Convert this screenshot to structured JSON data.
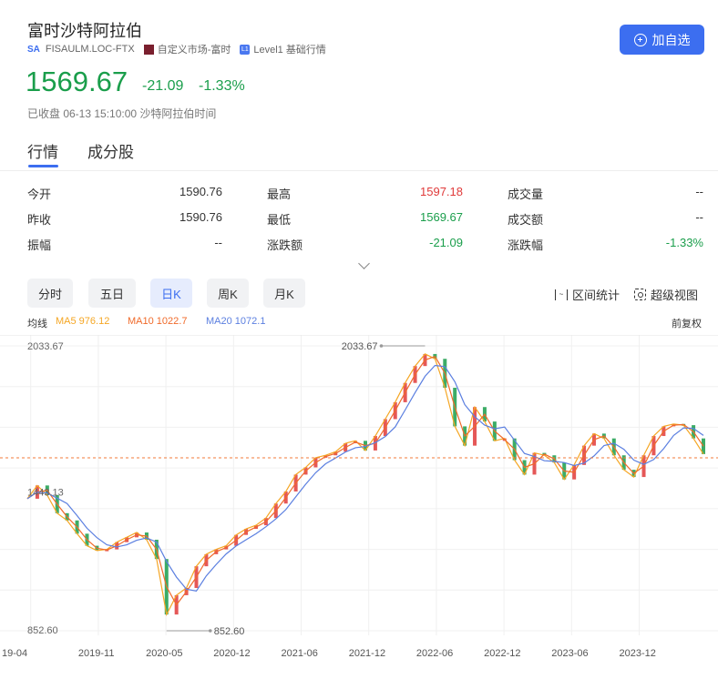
{
  "header": {
    "title": "富时沙特阿拉伯",
    "market_badge": "SA",
    "code": "FISAULM.LOC-FTX",
    "market_name": "自定义市场-富时",
    "level_badge": "L1",
    "level_text": "Level1 基础行情",
    "add_button": "加自选"
  },
  "quote": {
    "price": "1569.67",
    "change": "-21.09",
    "change_pct": "-1.33%",
    "status": "已收盘 06-13 15:10:00 沙特阿拉伯时间",
    "color_down": "#1a9e4b",
    "color_up": "#e03a3a"
  },
  "tabs": [
    {
      "label": "行情",
      "active": true
    },
    {
      "label": "成分股",
      "active": false
    }
  ],
  "stats": [
    {
      "label": "今开",
      "value": "1590.76",
      "color": "#333333"
    },
    {
      "label": "昨收",
      "value": "1590.76",
      "color": "#333333"
    },
    {
      "label": "振幅",
      "value": "--",
      "color": "#333333"
    },
    {
      "label": "最高",
      "value": "1597.18",
      "color": "#e03a3a"
    },
    {
      "label": "最低",
      "value": "1569.67",
      "color": "#1a9e4b"
    },
    {
      "label": "涨跌额",
      "value": "-21.09",
      "color": "#1a9e4b"
    },
    {
      "label": "成交量",
      "value": "--",
      "color": "#333333"
    },
    {
      "label": "成交额",
      "value": "--",
      "color": "#333333"
    },
    {
      "label": "涨跌幅",
      "value": "-1.33%",
      "color": "#1a9e4b"
    }
  ],
  "periods": [
    {
      "label": "分时",
      "active": false
    },
    {
      "label": "五日",
      "active": false
    },
    {
      "label": "日K",
      "active": true
    },
    {
      "label": "周K",
      "active": false
    },
    {
      "label": "月K",
      "active": false
    }
  ],
  "tools": {
    "range_stats": "区间统计",
    "super_view": "超级视图",
    "range_icon_glyph": "~"
  },
  "ma": {
    "label": "均线",
    "ma5": "MA5 976.12",
    "ma10": "MA10 1022.7",
    "ma20": "MA20 1072.1",
    "adjust": "前复权",
    "ma5_color": "#f5a623",
    "ma10_color": "#f06a2a",
    "ma20_color": "#5b7fe0"
  },
  "chart_data": {
    "type": "line",
    "y_tick_labels": [
      "2033.67",
      "1443.13",
      "852.60"
    ],
    "y_range": [
      852.6,
      2033.67
    ],
    "max_label": "2033.67",
    "min_label": "852.60",
    "current_price_line": 1569.67,
    "x_tick_labels": [
      "19-04",
      "2019-11",
      "2020-05",
      "2020-12",
      "2021-06",
      "2021-12",
      "2022-06",
      "2022-12",
      "2023-06",
      "2023-12"
    ],
    "series": [
      {
        "values": [
          1400,
          1455,
          1415,
          1340,
          1310,
          1255,
          1205,
          1185,
          1190,
          1220,
          1240,
          1260,
          1230,
          1150,
          920,
          1000,
          1030,
          1120,
          1170,
          1190,
          1205,
          1250,
          1275,
          1290,
          1320,
          1380,
          1430,
          1500,
          1530,
          1570,
          1580,
          1595,
          1630,
          1640,
          1600,
          1660,
          1730,
          1800,
          1880,
          1950,
          2000,
          1980,
          1860,
          1700,
          1620,
          1780,
          1720,
          1640,
          1650,
          1560,
          1500,
          1590,
          1580,
          1550,
          1480,
          1540,
          1620,
          1670,
          1650,
          1580,
          1520,
          1490,
          1580,
          1660,
          1700,
          1710,
          1705,
          1650,
          1585
        ]
      }
    ]
  }
}
